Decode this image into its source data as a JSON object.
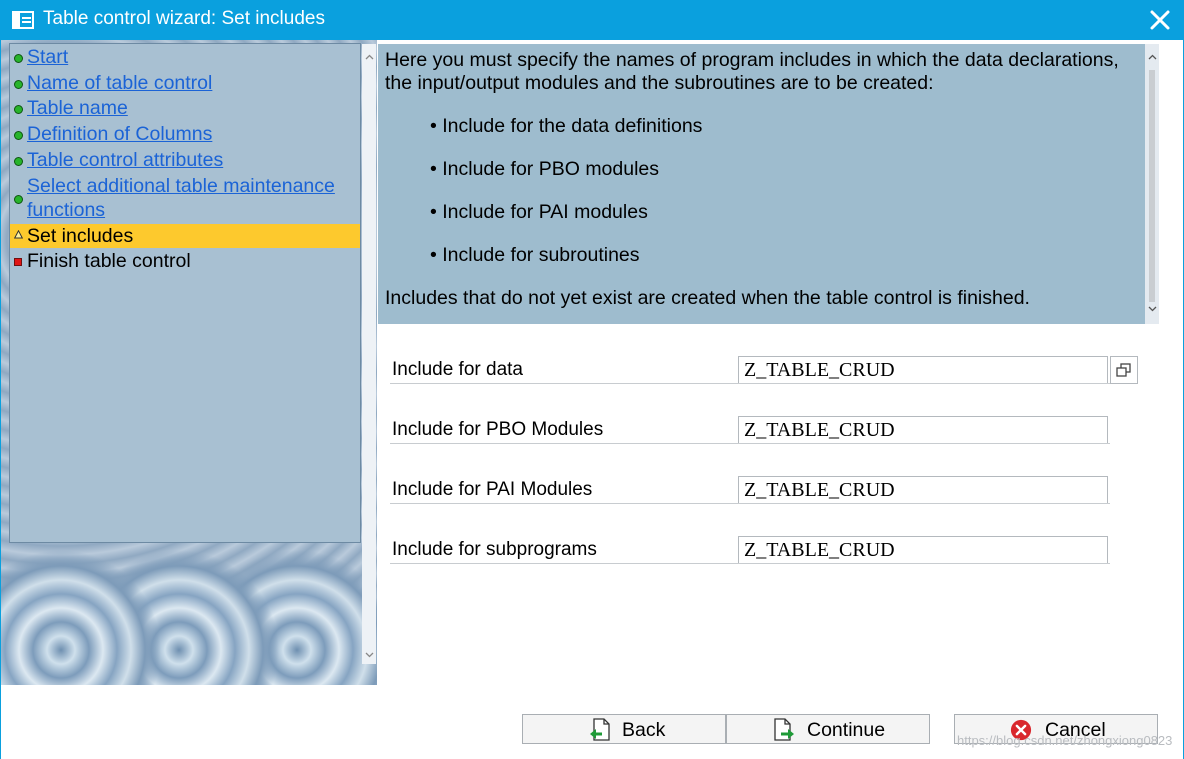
{
  "window": {
    "title": "Table control wizard: Set includes",
    "title_icon": "wizard-icon",
    "close_icon": "close-icon",
    "accent_color": "#0aa0de"
  },
  "nav": {
    "items": [
      {
        "label": "Start",
        "status": "done"
      },
      {
        "label": "Name of table control",
        "status": "done"
      },
      {
        "label": "Table name",
        "status": "done"
      },
      {
        "label": "Definition of Columns",
        "status": "done"
      },
      {
        "label": "Table control attributes",
        "status": "done"
      },
      {
        "label_line1": "Select additional table maintenance",
        "label_line2": "functions",
        "status": "done"
      },
      {
        "label": "Set includes",
        "status": "current"
      },
      {
        "label": "Finish table control",
        "status": "pending"
      }
    ],
    "active_color": "#fdc92d"
  },
  "info": {
    "intro_line1": "Here you must specify the names of program includes in which the data declarations,",
    "intro_line2": "the input/output modules and the subroutines are to be created:",
    "bullets": [
      "• Include for the data definitions",
      "• Include for PBO modules",
      "• Include for PAI modules",
      "• Include for subroutines"
    ],
    "footer": "Includes that do not yet exist are created when the table control is finished."
  },
  "form": {
    "fields": [
      {
        "label": "Include for data",
        "value": "Z_TABLE_CRUD"
      },
      {
        "label": "Include for PBO Modules",
        "value": "Z_TABLE_CRUD"
      },
      {
        "label": "Include for PAI Modules",
        "value": "Z_TABLE_CRUD"
      },
      {
        "label": "Include for subprograms",
        "value": "Z_TABLE_CRUD"
      }
    ],
    "value_help_icon": "value-help-icon"
  },
  "buttons": {
    "back": "Back",
    "continue": "Continue",
    "cancel": "Cancel"
  },
  "watermark": "https://blog.csdn.net/zhongxiong0823"
}
